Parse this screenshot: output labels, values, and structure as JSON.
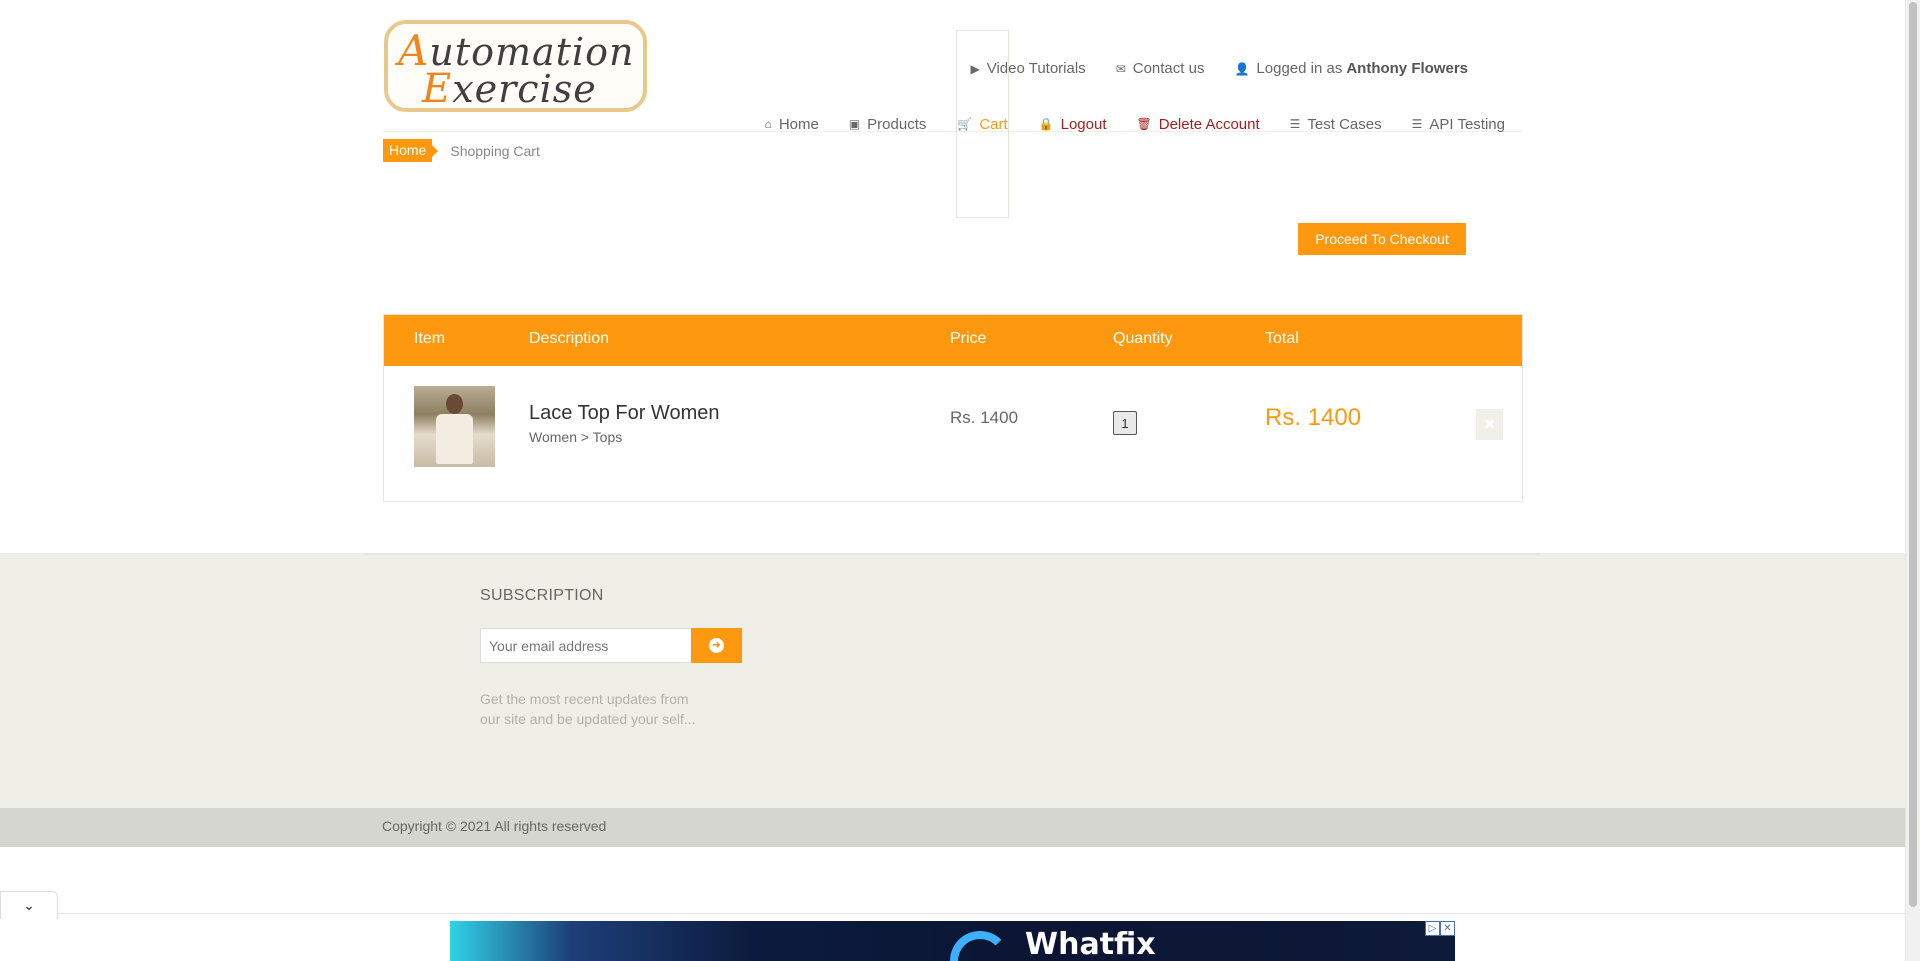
{
  "header": {
    "logo": {
      "line1_initial": "A",
      "line1_rest": "utomation",
      "line2_initial": "E",
      "line2_rest": "xercise"
    },
    "nav_row1": [
      {
        "icon": "home-icon",
        "glyph": "⌂",
        "label": "Home"
      },
      {
        "icon": "briefcase-icon",
        "glyph": "▣",
        "label": "Products"
      },
      {
        "icon": "cart-icon",
        "glyph": "🛒",
        "label": "Cart"
      },
      {
        "icon": "lock-icon",
        "glyph": "🔒",
        "label": "Logout"
      },
      {
        "icon": "trash-icon",
        "glyph": "🗑",
        "label": "Delete Account"
      },
      {
        "icon": "list-icon",
        "glyph": "☰",
        "label": "Test Cases"
      },
      {
        "icon": "list-icon",
        "glyph": "☰",
        "label": "API Testing"
      }
    ],
    "nav_row2": [
      {
        "icon": "youtube-play-icon",
        "glyph": "▶",
        "label": "Video Tutorials"
      },
      {
        "icon": "envelope-icon",
        "glyph": "✉",
        "label": "Contact us"
      },
      {
        "icon": "user-icon",
        "glyph": "👤",
        "label": "Logged in as"
      }
    ],
    "logged_in_user": "Anthony Flowers"
  },
  "breadcrumb": {
    "home": "Home",
    "current": "Shopping Cart"
  },
  "checkout_button": "Proceed To Checkout",
  "cart": {
    "columns": [
      "Item",
      "Description",
      "Price",
      "Quantity",
      "Total"
    ],
    "items": [
      {
        "name": "Lace Top For Women",
        "category": "Women > Tops",
        "price": "Rs. 1400",
        "quantity": "1",
        "total": "Rs. 1400",
        "delete_glyph": "✖"
      }
    ]
  },
  "footer": {
    "subscription_title": "SUBSCRIPTION",
    "email_placeholder": "Your email address",
    "subscribe_glyph": "➜",
    "subscription_text": "Get the most recent updates from our site and be updated your self...",
    "copyright": "Copyright © 2021 All rights reserved"
  },
  "ad": {
    "brand": "Whatfix",
    "collapse_glyph": "⌄",
    "adchoices_glyph": "▷",
    "close_glyph": "✕"
  },
  "colors": {
    "accent": "#fe980f",
    "danger": "#a41f1f",
    "text": "#696763"
  }
}
